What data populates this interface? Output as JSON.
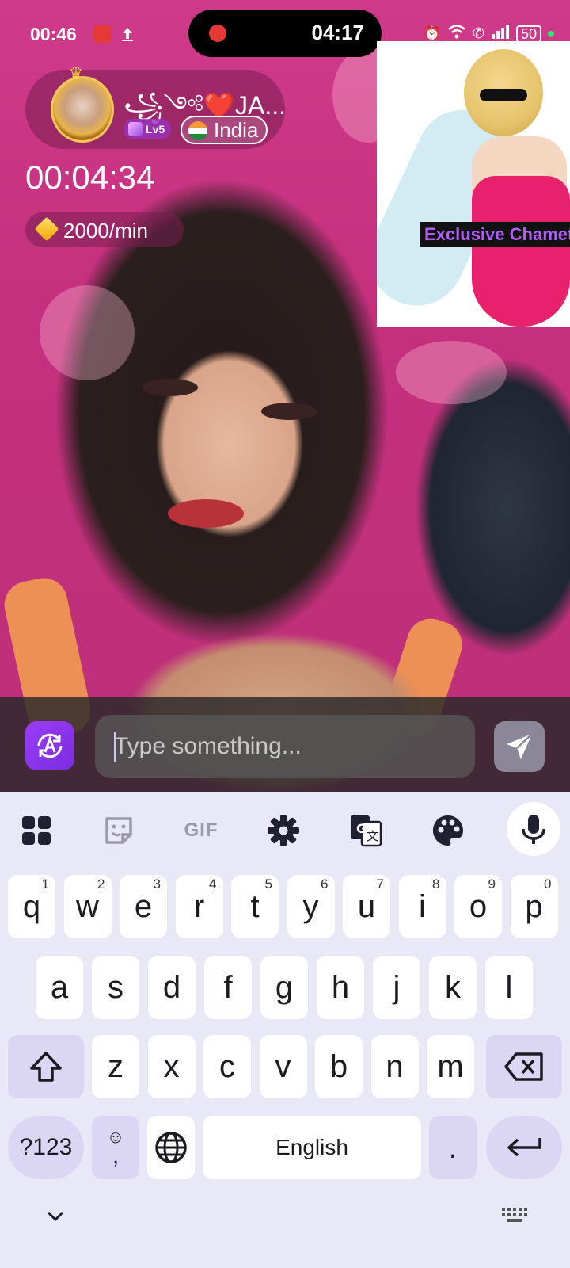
{
  "status_bar": {
    "time": "00:46",
    "recording_time": "04:17",
    "battery": "50"
  },
  "host": {
    "name": "꧁༺❤️JA...",
    "level": "Lv5",
    "country": "India"
  },
  "call": {
    "timer": "00:04:34",
    "rate": "2000/min"
  },
  "ad": {
    "caption": "Exclusive Chamet"
  },
  "chat": {
    "placeholder": "Type something..."
  },
  "keyboard": {
    "toolbar": [
      "apps-grid",
      "sticker",
      "GIF",
      "settings",
      "translate",
      "theme-palette",
      "microphone"
    ],
    "gif_label": "GIF",
    "row1": [
      {
        "k": "q",
        "n": "1"
      },
      {
        "k": "w",
        "n": "2"
      },
      {
        "k": "e",
        "n": "3"
      },
      {
        "k": "r",
        "n": "4"
      },
      {
        "k": "t",
        "n": "5"
      },
      {
        "k": "y",
        "n": "6"
      },
      {
        "k": "u",
        "n": "7"
      },
      {
        "k": "i",
        "n": "8"
      },
      {
        "k": "o",
        "n": "9"
      },
      {
        "k": "p",
        "n": "0"
      }
    ],
    "row2": [
      "a",
      "s",
      "d",
      "f",
      "g",
      "h",
      "j",
      "k",
      "l"
    ],
    "row3": [
      "z",
      "x",
      "c",
      "v",
      "b",
      "n",
      "m"
    ],
    "symbols_label": "?123",
    "comma_label": ",",
    "space_label": "English",
    "period_label": "."
  },
  "colors": {
    "accent_purple": "#8b34ef",
    "keyboard_bg": "#e9e8f6",
    "fn_key": "#dcd6f5"
  }
}
